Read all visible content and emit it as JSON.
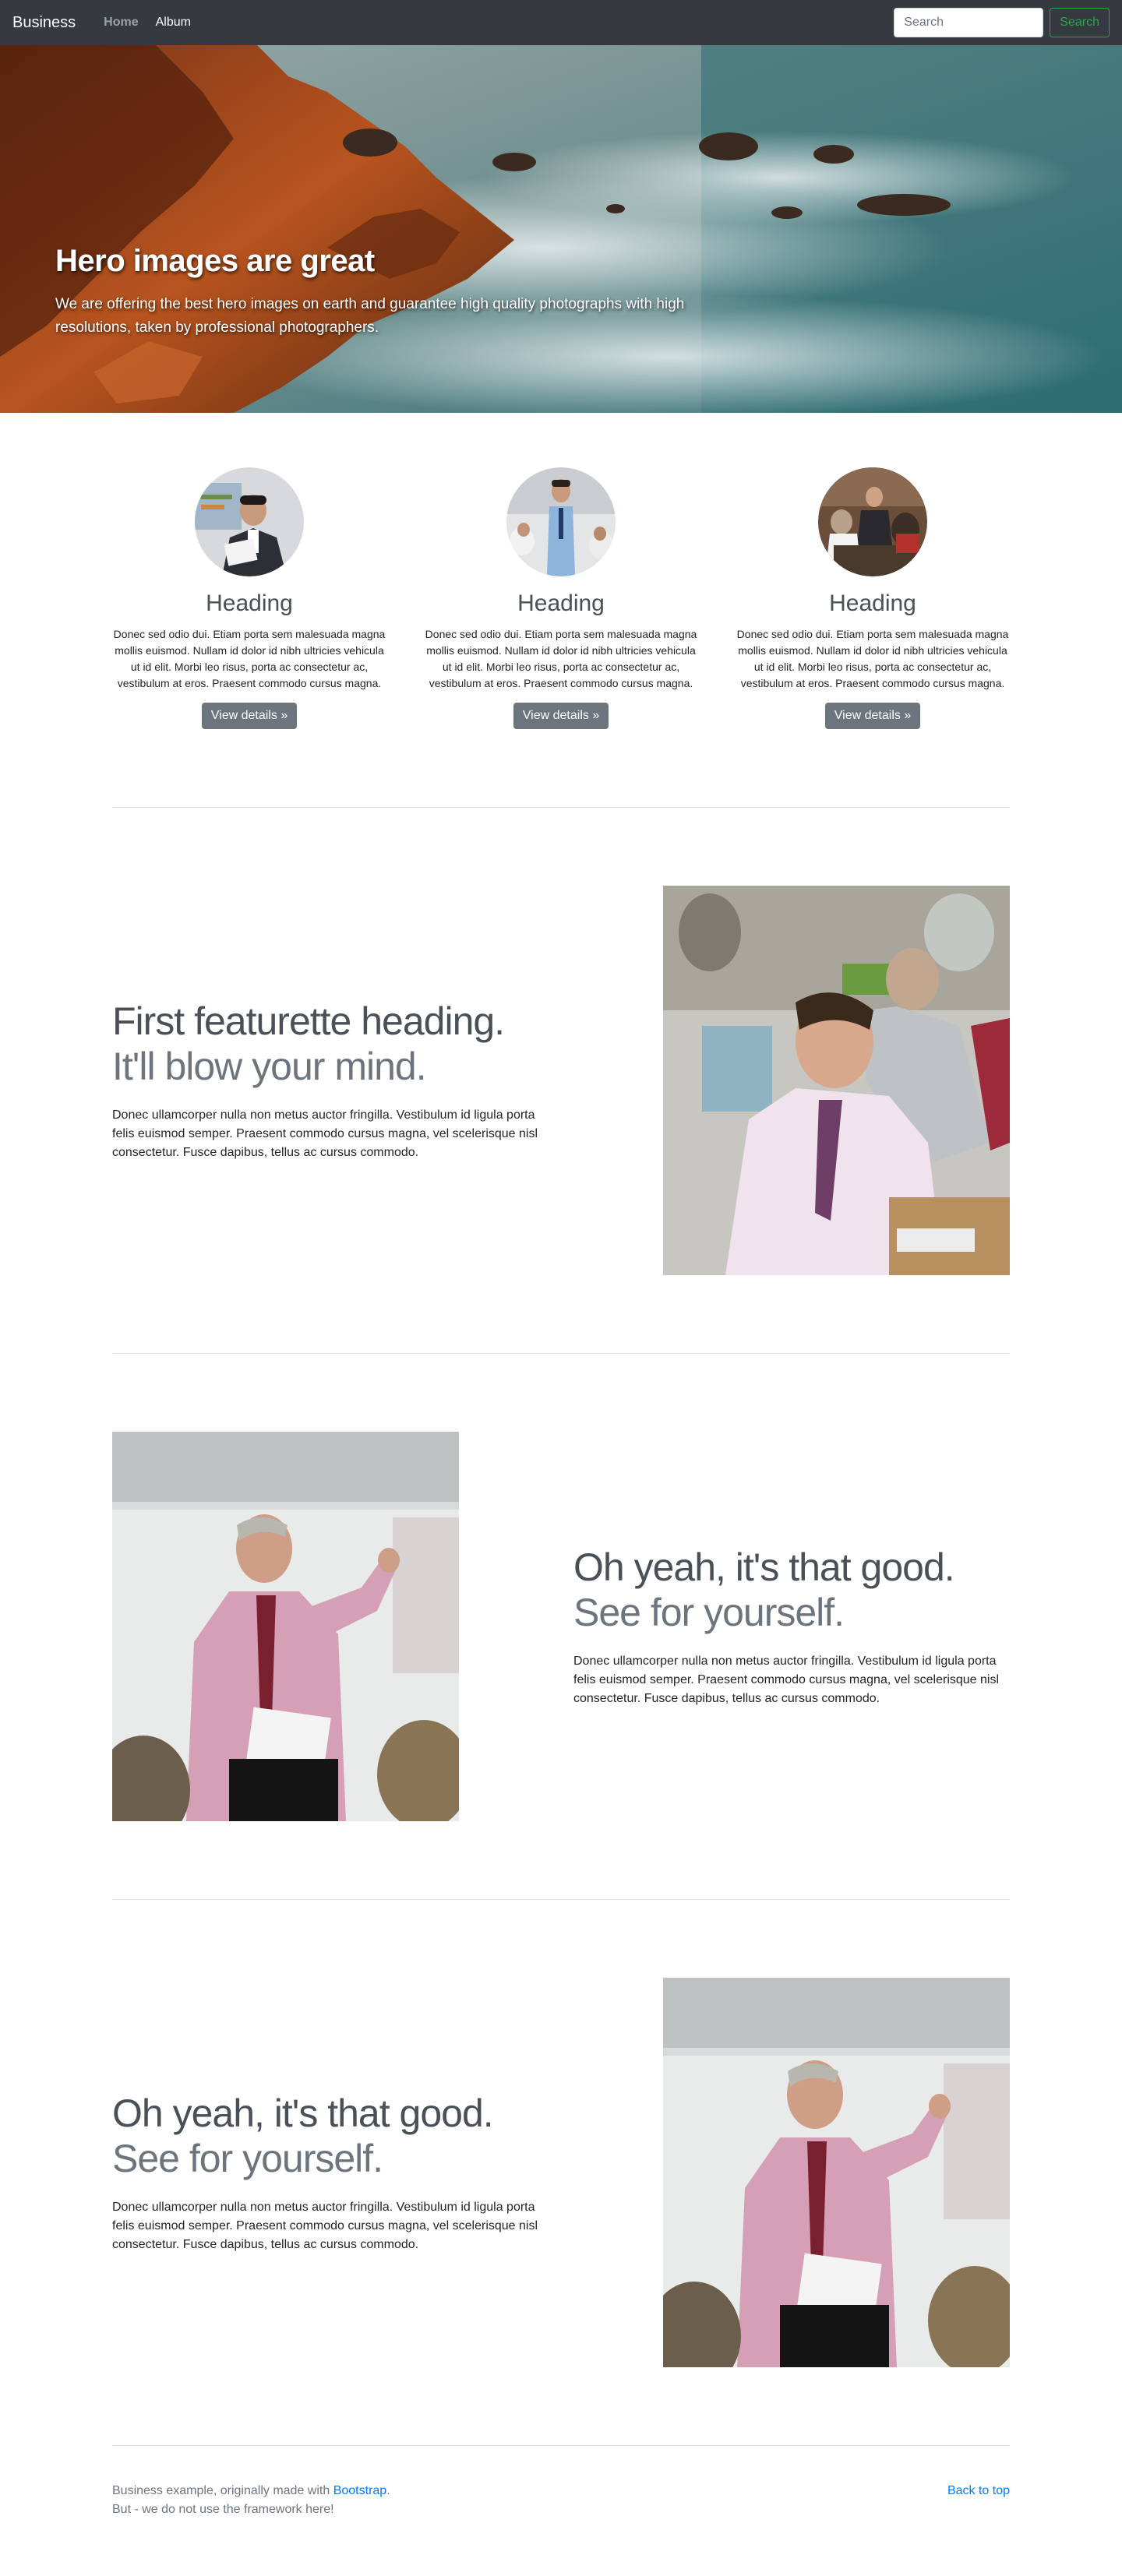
{
  "navbar": {
    "brand": "Business",
    "links": [
      {
        "label": "Home",
        "active": true
      },
      {
        "label": "Album",
        "active": false
      }
    ],
    "search_placeholder": "Search",
    "search_button": "Search"
  },
  "hero": {
    "title": "Hero images are great",
    "subtitle": "We are offering the best hero images on earth and guarantee high quality photographs with high resolutions, taken by professional photographers."
  },
  "marketing": [
    {
      "heading": "Heading",
      "text": "Donec sed odio dui. Etiam porta sem malesuada magna mollis euismod. Nullam id dolor id nibh ultricies vehicula ut id elit. Morbi leo risus, porta ac consectetur ac, vestibulum at eros. Praesent commodo cursus magna.",
      "button": "View details »"
    },
    {
      "heading": "Heading",
      "text": "Donec sed odio dui. Etiam porta sem malesuada magna mollis euismod. Nullam id dolor id nibh ultricies vehicula ut id elit. Morbi leo risus, porta ac consectetur ac, vestibulum at eros. Praesent commodo cursus magna.",
      "button": "View details »"
    },
    {
      "heading": "Heading",
      "text": "Donec sed odio dui. Etiam porta sem malesuada magna mollis euismod. Nullam id dolor id nibh ultricies vehicula ut id elit. Morbi leo risus, porta ac consectetur ac, vestibulum at eros. Praesent commodo cursus magna.",
      "button": "View details »"
    }
  ],
  "featurettes": [
    {
      "heading": "First featurette heading.",
      "muted": "It'll blow your mind.",
      "text": "Donec ullamcorper nulla non metus auctor fringilla. Vestibulum id ligula porta felis euismod semper. Praesent commodo cursus magna, vel scelerisque nisl consectetur. Fusce dapibus, tellus ac cursus commodo."
    },
    {
      "heading": "Oh yeah, it's that good.",
      "muted": "See for yourself.",
      "text": "Donec ullamcorper nulla non metus auctor fringilla. Vestibulum id ligula porta felis euismod semper. Praesent commodo cursus magna, vel scelerisque nisl consectetur. Fusce dapibus, tellus ac cursus commodo."
    },
    {
      "heading": "Oh yeah, it's that good.",
      "muted": "See for yourself.",
      "text": "Donec ullamcorper nulla non metus auctor fringilla. Vestibulum id ligula porta felis euismod semper. Praesent commodo cursus magna, vel scelerisque nisl consectetur. Fusce dapibus, tellus ac cursus commodo."
    }
  ],
  "footer": {
    "line1_prefix": "Business example, originally made with",
    "line1_link": "Bootstrap",
    "line1_suffix": ".",
    "line2": "But - we do not use the framework here!",
    "back_to_top": "Back to top"
  },
  "colors": {
    "navbar_bg": "#343a40",
    "search_accent": "#28a745",
    "button_secondary": "#6c757d",
    "link": "#007bff",
    "muted_text": "#6c757d"
  }
}
